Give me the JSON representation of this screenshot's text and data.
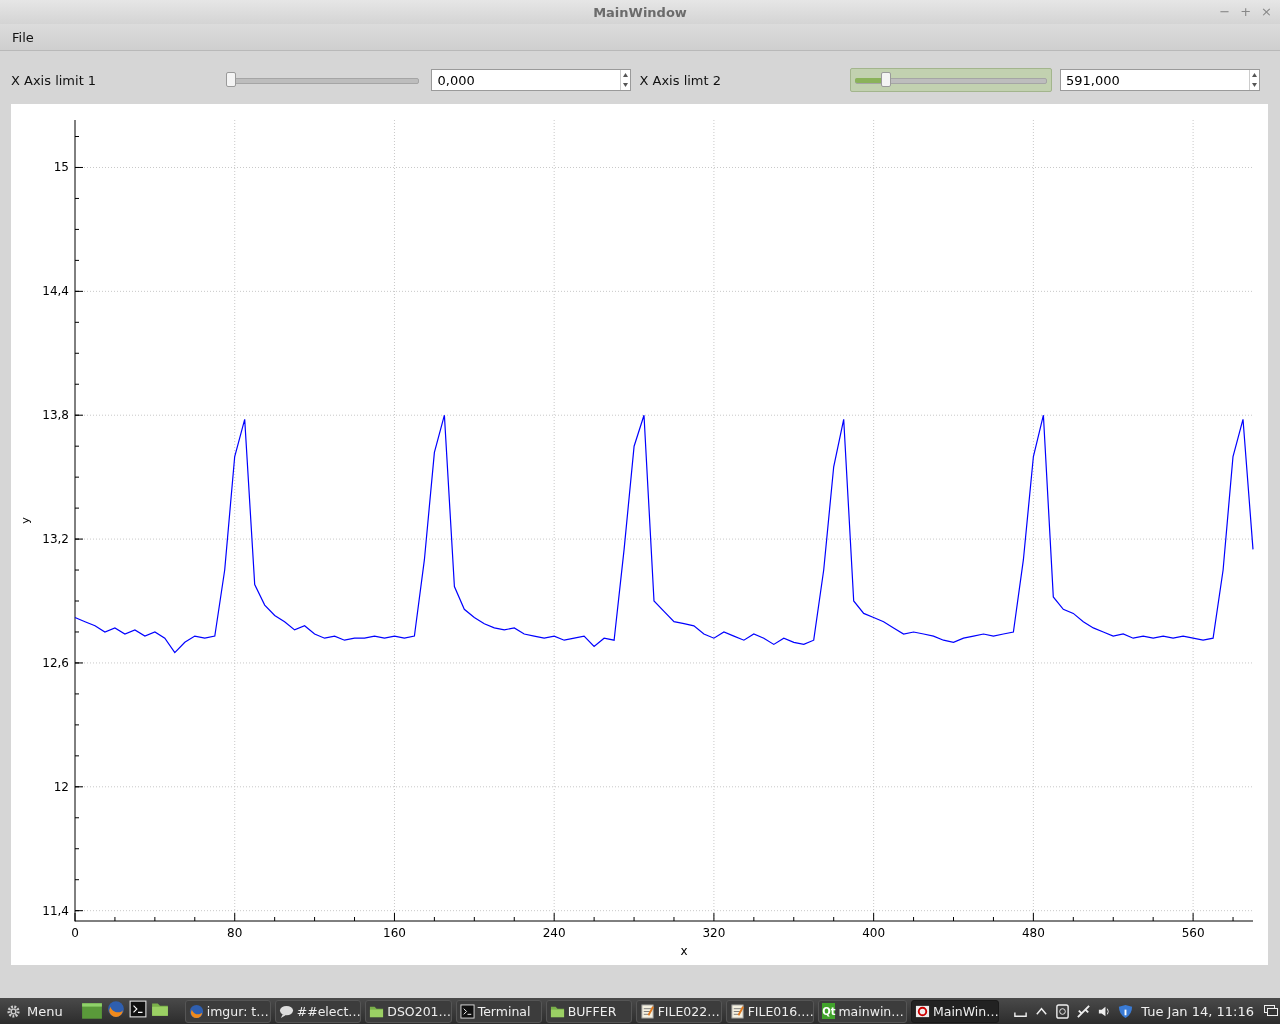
{
  "window": {
    "title": "MainWindow",
    "controls": [
      "−",
      "+",
      "×"
    ]
  },
  "menu": [
    "File"
  ],
  "controls": [
    {
      "label": "X Axis limit 1",
      "slider": {
        "level": 0.0,
        "focused": false
      },
      "spin": {
        "value": "0,000"
      }
    },
    {
      "label": "X Axis limt 2",
      "slider": {
        "level": 0.15,
        "focused": true
      },
      "spin": {
        "value": "591,000"
      }
    }
  ],
  "plot": {
    "chart_data": {
      "type": "line",
      "xlabel": "x",
      "ylabel": "y",
      "grid": true,
      "xlim": [
        0,
        590
      ],
      "ylim": [
        11.35,
        15.23
      ],
      "xticks": [
        0,
        80,
        160,
        240,
        320,
        400,
        480,
        560
      ],
      "yticks": [
        {
          "value": 11.4,
          "label": "11,4"
        },
        {
          "value": 12,
          "label": "12"
        },
        {
          "value": 12.6,
          "label": "12,6"
        },
        {
          "value": 13.2,
          "label": "13,2"
        },
        {
          "value": 13.8,
          "label": "13,8"
        },
        {
          "value": 14.4,
          "label": "14,4"
        },
        {
          "value": 15,
          "label": "15"
        }
      ],
      "x": [
        0,
        5,
        10,
        15,
        20,
        25,
        30,
        35,
        40,
        45,
        50,
        55,
        60,
        65,
        70,
        75,
        80,
        85,
        90,
        95,
        100,
        105,
        110,
        115,
        120,
        125,
        130,
        135,
        140,
        145,
        150,
        155,
        160,
        165,
        170,
        175,
        180,
        185,
        190,
        195,
        200,
        205,
        210,
        215,
        220,
        225,
        230,
        235,
        240,
        245,
        250,
        255,
        260,
        265,
        270,
        275,
        280,
        285,
        290,
        295,
        300,
        305,
        310,
        315,
        320,
        325,
        330,
        335,
        340,
        345,
        350,
        355,
        360,
        365,
        370,
        375,
        380,
        385,
        390,
        395,
        400,
        405,
        410,
        415,
        420,
        425,
        430,
        435,
        440,
        445,
        450,
        455,
        460,
        465,
        470,
        475,
        480,
        485,
        490,
        495,
        500,
        505,
        510,
        515,
        520,
        525,
        530,
        535,
        540,
        545,
        550,
        555,
        560,
        565,
        570,
        575,
        580,
        585,
        590
      ],
      "series": [
        {
          "color": "#0000ff",
          "values": [
            12.82,
            12.8,
            12.78,
            12.75,
            12.77,
            12.74,
            12.76,
            12.73,
            12.75,
            12.72,
            12.65,
            12.7,
            12.73,
            12.72,
            12.73,
            13.05,
            13.6,
            13.78,
            12.98,
            12.88,
            12.83,
            12.8,
            12.76,
            12.78,
            12.74,
            12.72,
            12.73,
            12.71,
            12.72,
            12.72,
            12.73,
            12.72,
            12.73,
            12.72,
            12.73,
            13.1,
            13.62,
            13.8,
            12.97,
            12.86,
            12.82,
            12.79,
            12.77,
            12.76,
            12.77,
            12.74,
            12.73,
            12.72,
            12.73,
            12.71,
            12.72,
            12.73,
            12.68,
            12.72,
            12.71,
            13.15,
            13.65,
            13.8,
            12.9,
            12.85,
            12.8,
            12.79,
            12.78,
            12.74,
            12.72,
            12.75,
            12.73,
            12.71,
            12.74,
            12.72,
            12.69,
            12.72,
            12.7,
            12.69,
            12.71,
            13.05,
            13.55,
            13.78,
            12.9,
            12.84,
            12.82,
            12.8,
            12.77,
            12.74,
            12.75,
            12.74,
            12.73,
            12.71,
            12.7,
            12.72,
            12.73,
            12.74,
            12.73,
            12.74,
            12.75,
            13.1,
            13.6,
            13.8,
            12.92,
            12.86,
            12.84,
            12.8,
            12.77,
            12.75,
            12.73,
            12.74,
            12.72,
            12.73,
            12.72,
            12.73,
            12.72,
            12.73,
            12.72,
            12.71,
            12.72,
            13.05,
            13.6,
            13.78,
            13.15
          ]
        }
      ]
    }
  },
  "taskbar": {
    "menu_label": "Menu",
    "launchers": [
      {
        "kind": "desktop"
      },
      {
        "kind": "firefox"
      },
      {
        "kind": "terminal"
      },
      {
        "kind": "folder"
      }
    ],
    "tasks": [
      {
        "kind": "firefox",
        "label": "imgur: t…",
        "selected": false
      },
      {
        "kind": "chat",
        "label": "##elect…",
        "selected": false
      },
      {
        "kind": "folder",
        "label": "DSO201…",
        "selected": false
      },
      {
        "kind": "terminal",
        "label": "Terminal",
        "selected": false
      },
      {
        "kind": "folder",
        "label": "BUFFER",
        "selected": false
      },
      {
        "kind": "note",
        "label": "FILE022…",
        "selected": false
      },
      {
        "kind": "note",
        "label": "FILE016.…",
        "selected": false
      },
      {
        "kind": "qt",
        "badge": "Qt",
        "label": "mainwin…",
        "selected": false
      },
      {
        "kind": "app",
        "label": "MainWin…",
        "selected": true
      }
    ],
    "tray": [
      {
        "kind": "keyboard"
      },
      {
        "kind": "up"
      },
      {
        "kind": "clipboard"
      },
      {
        "kind": "network"
      },
      {
        "kind": "volume"
      },
      {
        "kind": "shield"
      }
    ],
    "clock": "Tue Jan 14, 11:16"
  }
}
